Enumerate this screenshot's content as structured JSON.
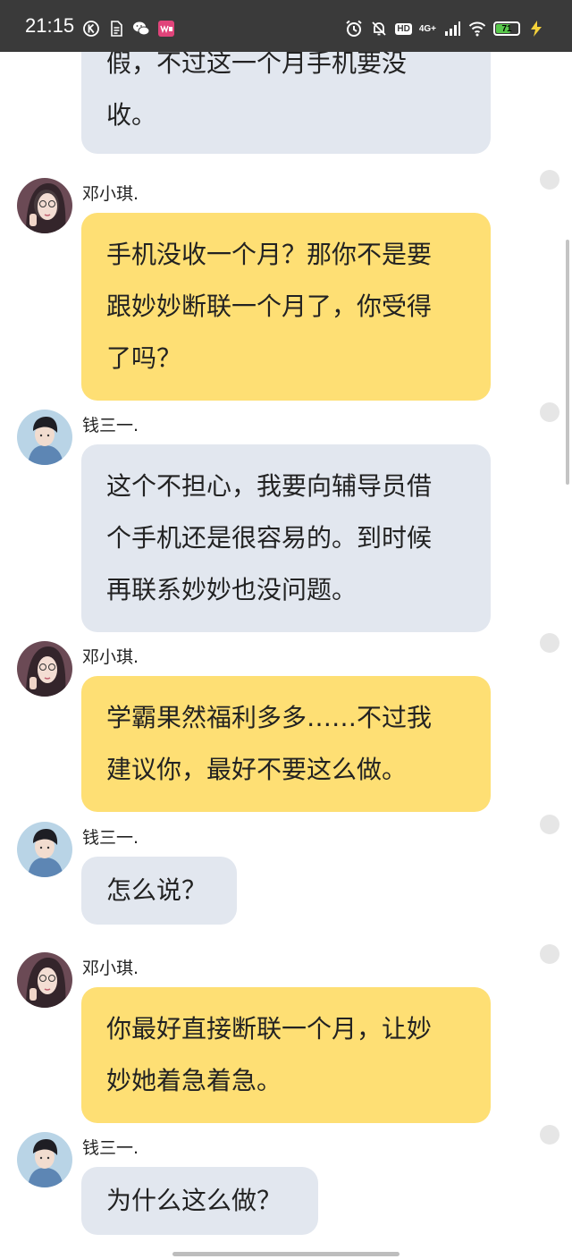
{
  "status_bar": {
    "time": "21:15",
    "left_icons": [
      "k-badge-icon",
      "document-icon",
      "wechat-icon",
      "app-icon"
    ],
    "right_icons": [
      "alarm-icon",
      "mute-icon",
      "hd-icon",
      "signal-icon",
      "wifi-icon",
      "battery-icon",
      "charging-icon"
    ],
    "hd_label": "HD",
    "network_label": "4G+",
    "battery_level": "71",
    "battery_fraction": 0.71,
    "battery_color": "#58c84b"
  },
  "colors": {
    "status_bar_bg": "#3a3a3a",
    "gray_bubble": "#e2e7ef",
    "yellow_bubble": "#fedf74",
    "text": "#222222"
  },
  "messages": [
    {
      "sender": "",
      "avatar": "",
      "lines": [
        "假，不过这一个月手机要没",
        "收。"
      ]
    },
    {
      "sender": "邓小琪.",
      "avatar": "female-avatar",
      "lines": [
        "手机没收一个月？那你不是要",
        "跟妙妙断联一个月了，你受得",
        "了吗？"
      ]
    },
    {
      "sender": "钱三一.",
      "avatar": "male-avatar",
      "lines": [
        "这个不担心，我要向辅导员借",
        "个手机还是很容易的。到时候",
        "再联系妙妙也没问题。"
      ]
    },
    {
      "sender": "邓小琪.",
      "avatar": "female-avatar",
      "lines": [
        "学霸果然福利多多……不过我",
        "建议你，最好不要这么做。"
      ]
    },
    {
      "sender": "钱三一.",
      "avatar": "male-avatar",
      "lines": [
        "怎么说？"
      ]
    },
    {
      "sender": "邓小琪.",
      "avatar": "female-avatar",
      "lines": [
        "你最好直接断联一个月，让妙",
        "妙她着急着急。"
      ]
    },
    {
      "sender": "钱三一.",
      "avatar": "male-avatar",
      "lines": [
        "为什么这么做？"
      ]
    }
  ]
}
